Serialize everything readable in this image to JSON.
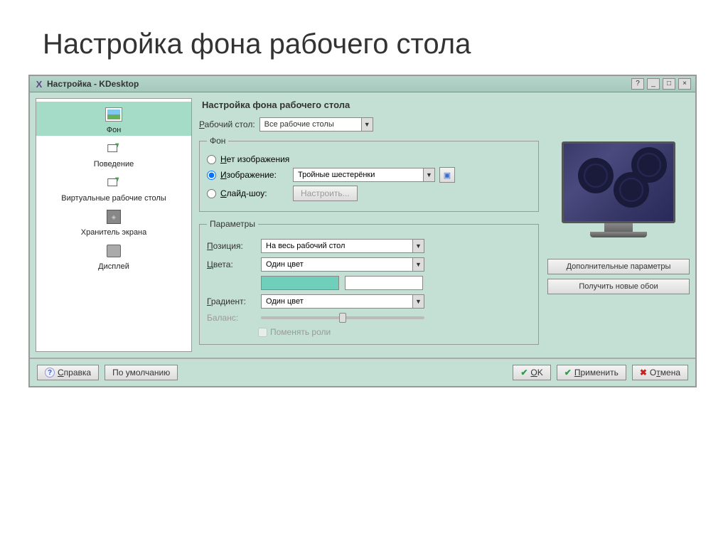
{
  "slide": {
    "title": "Настройка фона рабочего стола"
  },
  "titlebar": {
    "text": "Настройка - KDesktop",
    "help": "?",
    "min": "_",
    "max": "□",
    "close": "×"
  },
  "sidebar": {
    "items": [
      {
        "label": "Фон",
        "selected": true
      },
      {
        "label": "Поведение",
        "selected": false
      },
      {
        "label": "Виртуальные рабочие столы",
        "selected": false
      },
      {
        "label": "Хранитель экрана",
        "selected": false
      },
      {
        "label": "Дисплей",
        "selected": false
      }
    ]
  },
  "main": {
    "heading": "Настройка фона рабочего стола",
    "desktop_label": "Рабочий стол:",
    "desktop_value": "Все рабочие столы"
  },
  "bg_group": {
    "legend": "Фон",
    "no_image": "Нет изображения",
    "image": "Изображение:",
    "image_value": "Тройные шестерёнки",
    "slideshow": "Слайд-шоу:",
    "configure": "Настроить..."
  },
  "params_group": {
    "legend": "Параметры",
    "position": "Позиция:",
    "position_value": "На весь рабочий стол",
    "colors": "Цвета:",
    "colors_value": "Один цвет",
    "gradient": "Градиент:",
    "gradient_value": "Один цвет",
    "balance": "Баланс:",
    "swap_roles": "Поменять роли"
  },
  "right": {
    "advanced": "Дополнительные параметры",
    "get_wallpapers": "Получить новые обои"
  },
  "footer": {
    "help": "Справка",
    "defaults": "По умолчанию",
    "ok": "OK",
    "apply": "Применить",
    "cancel": "Отмена"
  }
}
